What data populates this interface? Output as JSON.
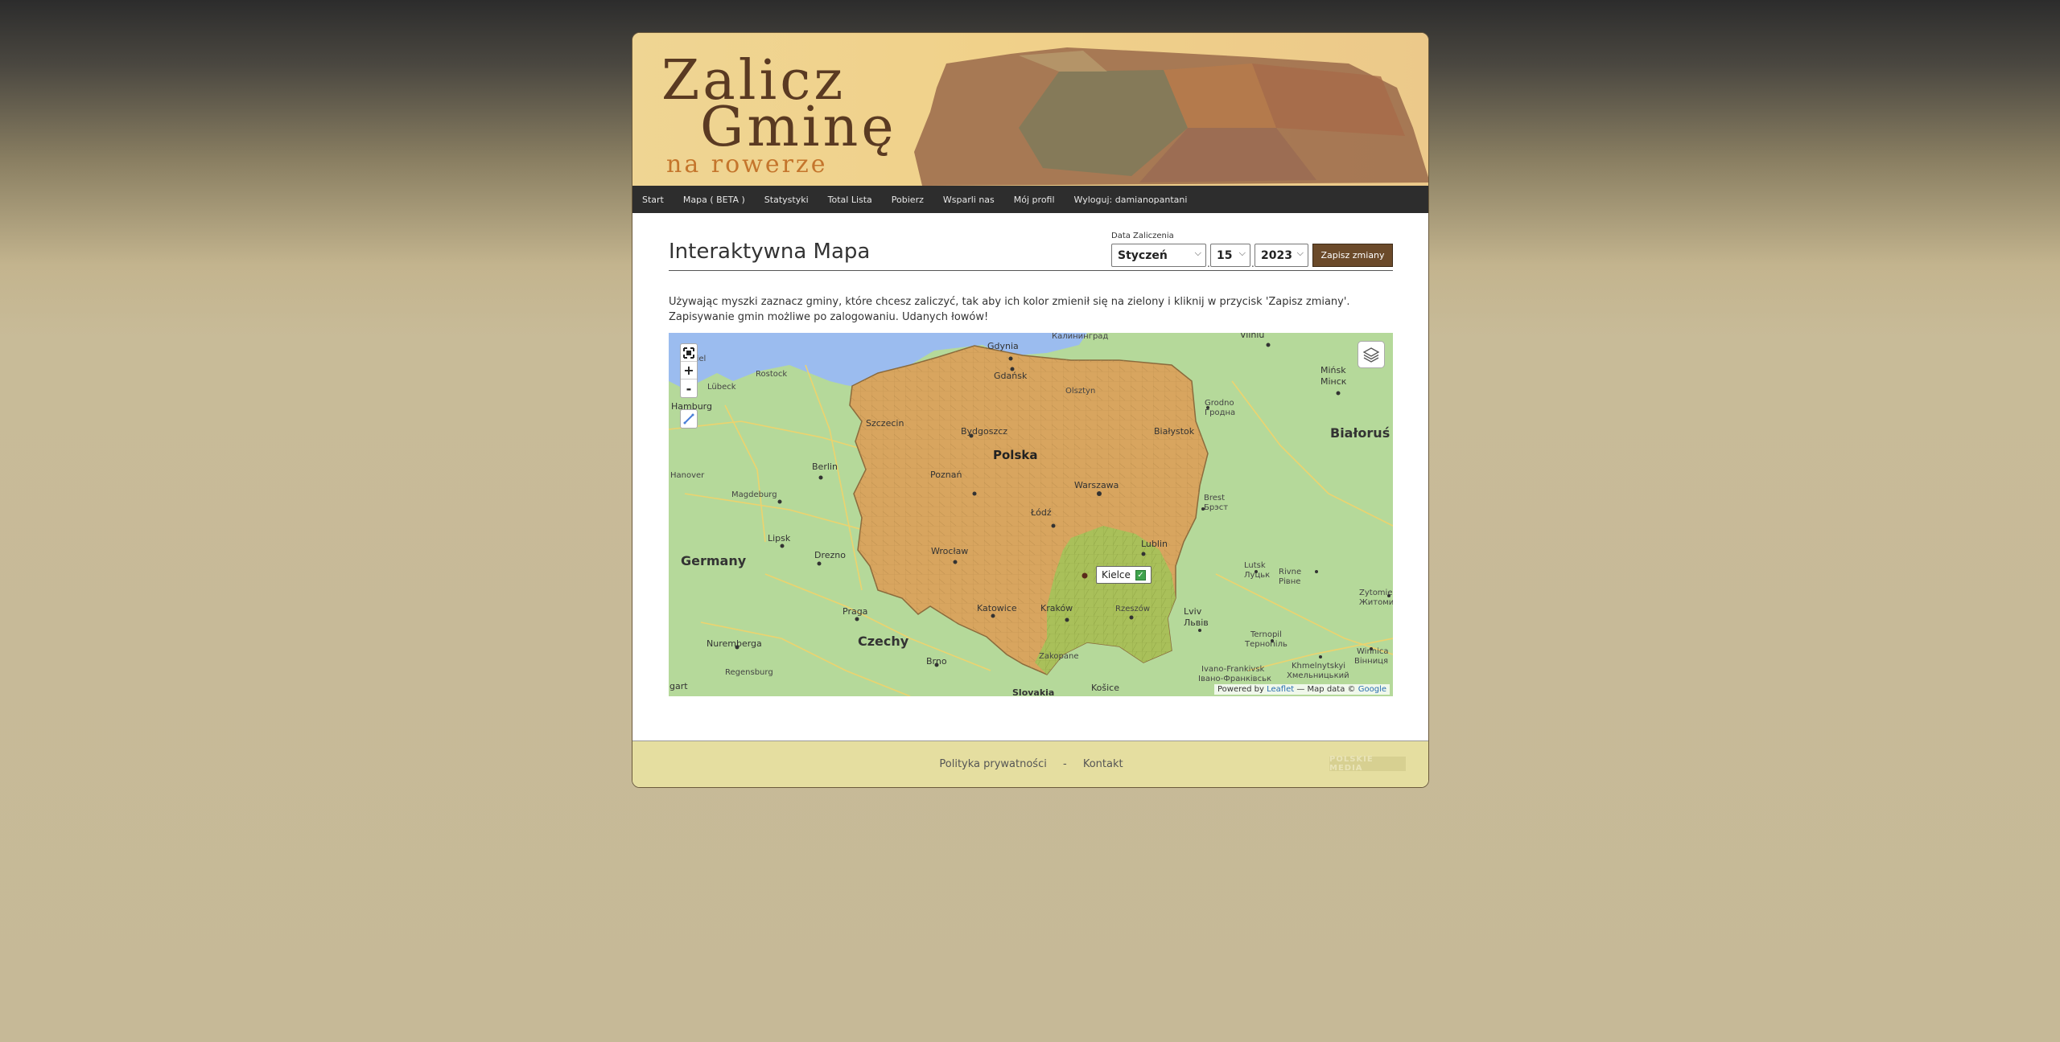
{
  "logo": {
    "line1": "Zalicz",
    "line2": "Gminę",
    "line3": "na rowerze"
  },
  "nav": [
    "Start",
    "Mapa ( BETA )",
    "Statystyki",
    "Total Lista",
    "Pobierz",
    "Wsparli nas",
    "Mój profil",
    "Wyloguj: damianopantani"
  ],
  "main": {
    "title": "Interaktywna Mapa",
    "date_label": "Data Zaliczenia",
    "month": "Styczeń",
    "day": "15",
    "year": "2023",
    "save_label": "Zapisz zmiany",
    "instructions_line1": "Używając myszki zaznacz gminy, które chcesz zaliczyć, tak aby ich kolor zmienił się na zielony i kliknij w przycisk 'Zapisz zmiany'.",
    "instructions_line2": "Zapisywanie gmin możliwe po zalogowaniu. Udanych łowów!"
  },
  "map": {
    "controls": {
      "zoom_in": "+",
      "zoom_out": "-"
    },
    "popup": "Kielce",
    "labels": {
      "poland": "Polska",
      "germany": "Germany",
      "czechy": "Czechy",
      "bialorus": "Białoruś",
      "gdynia": "Gdynia",
      "gdansk": "Gdańsk",
      "olsztyn": "Olsztyn",
      "szczecin": "Szczecin",
      "bydgoszcz": "Bydgoszcz",
      "bialystok": "Białystok",
      "poznan": "Poznań",
      "warszawa": "Warszawa",
      "lodz": "Łódź",
      "lublin": "Lublin",
      "wroclaw": "Wrocław",
      "katowice": "Katowice",
      "krakow": "Kraków",
      "rzeszow": "Rzeszów",
      "zakopane": "Zakopane",
      "kosice": "Košice",
      "lviv1": "Lviv",
      "lviv2": "Львів",
      "berlin": "Berlin",
      "hamburg": "Hamburg",
      "hanover": "Hanover",
      "magdeburg": "Magdeburg",
      "lipsk": "Lipsk",
      "drezno": "Drezno",
      "praga": "Praga",
      "nuremberga": "Nuremberga",
      "regensburg": "Regensburg",
      "brno": "Brno",
      "stuttgart": "gart",
      "rostock": "Rostock",
      "lubeck": "Lübeck",
      "kiel": "Kiel",
      "kaliningrad": "Калининград",
      "vilnius": "Vilniu",
      "minsk1": "Mińsk",
      "minsk2": "Мінск",
      "grodno1": "Grodno",
      "grodno2": "Гродна",
      "brest1": "Brest",
      "brest2": "Брэст",
      "lutsk1": "Lutsk",
      "lutsk2": "Луцьк",
      "rivne1": "Rivne",
      "rivne2": "Рівне",
      "zhytomyr1": "Zytomie",
      "zhytomyr2": "Житоми",
      "ternopil1": "Ternopil",
      "ternopil2": "Тернопіль",
      "khmelnytskyi1": "Khmelnytskyi",
      "khmelnytskyi2": "Хмельницький",
      "ivano1": "Ivano-Frankivsk",
      "ivano2": "Івано-Франківськ",
      "vinnytsia1": "Winnica",
      "vinnytsia2": "Вінниця",
      "slovakia": "Slovakia"
    },
    "attribution_prefix": "Powered by",
    "attribution_leaflet": "Leaflet",
    "attribution_middle": "— Map data ©",
    "attribution_google": "Google"
  },
  "footer": {
    "privacy": "Polityka prywatności",
    "separator": "-",
    "contact": "Kontakt",
    "brand": "POLSKIE MEDIA"
  },
  "colors": {
    "nav_bg": "#2d2d2d",
    "save_bg": "#6b4a2a",
    "poland_fill": "#d8a55f",
    "selected_fill": "#a9c05a",
    "footer_bg": "#e5dea0"
  }
}
